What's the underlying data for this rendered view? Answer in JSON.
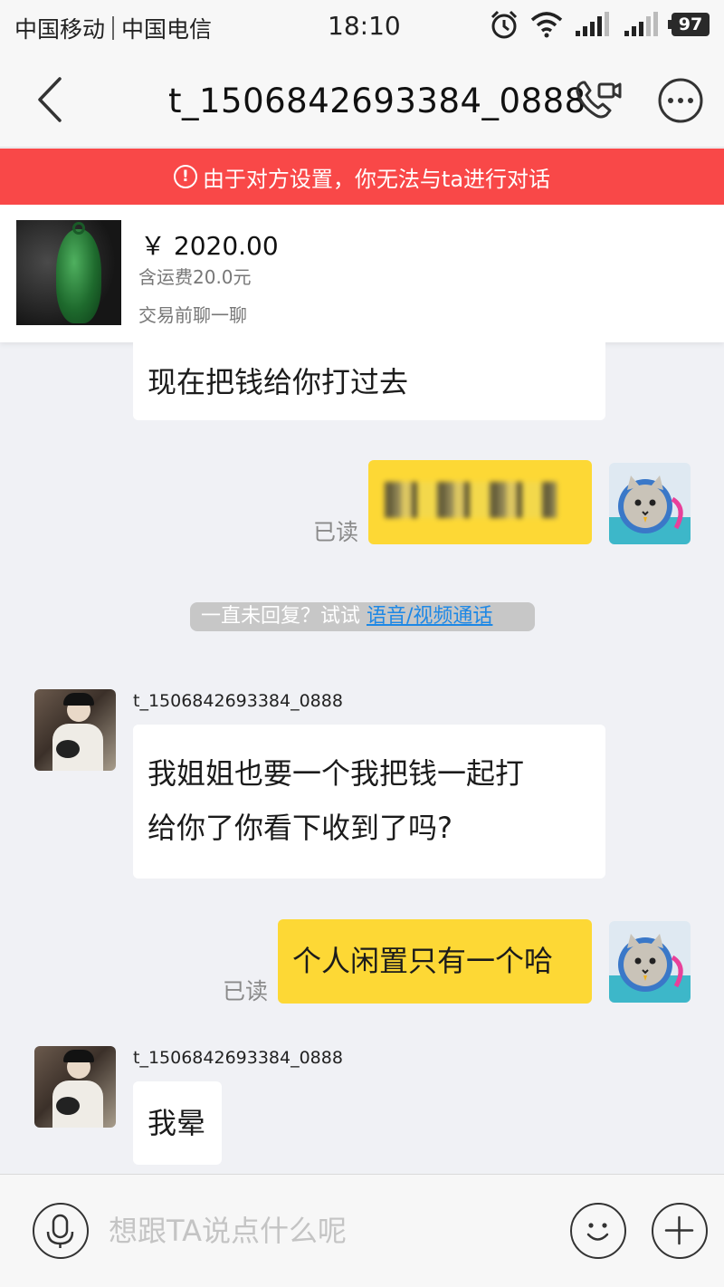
{
  "status_bar": {
    "carrier_1": "中国移动",
    "carrier_2": "中国电信",
    "time": "18:10",
    "battery": "97",
    "icons": [
      "alarm-icon",
      "wifi-icon",
      "signal-icon",
      "signal-icon",
      "battery-icon"
    ]
  },
  "header": {
    "title": "t_1506842693384_0888",
    "icons": [
      "back-icon",
      "video-call-icon",
      "more-icon"
    ]
  },
  "warning": {
    "text": "由于对方设置，你无法与ta进行对话",
    "icon": "!",
    "color": "#f94848"
  },
  "product": {
    "price": "￥ 2020.00",
    "shipping": "含运费20.0元",
    "note": "交易前聊一聊"
  },
  "messages": [
    {
      "direction": "in",
      "text": "现在把钱给你打过去"
    },
    {
      "direction": "out",
      "text": "",
      "read": "已读"
    },
    {
      "direction": "out",
      "text": "个人闲置只有一个哈",
      "read": "已读"
    }
  ],
  "incoming": [
    {
      "sender": "t_1506842693384_0888",
      "lines": [
        "我姐姐也要一个我把钱一起打",
        "给你了你看下收到了吗?"
      ]
    },
    {
      "sender": "t_1506842693384_0888",
      "lines": [
        "我晕"
      ]
    }
  ],
  "hint": {
    "text": "一直未回复？试试 ",
    "link": "语音/视频通话"
  },
  "input": {
    "placeholder": "想跟TA说点什么呢"
  },
  "colors": {
    "background": "#f0f1f5",
    "outgoing_bubble": "#fdd835",
    "incoming_bubble": "#ffffff",
    "link": "#1e88e5"
  }
}
